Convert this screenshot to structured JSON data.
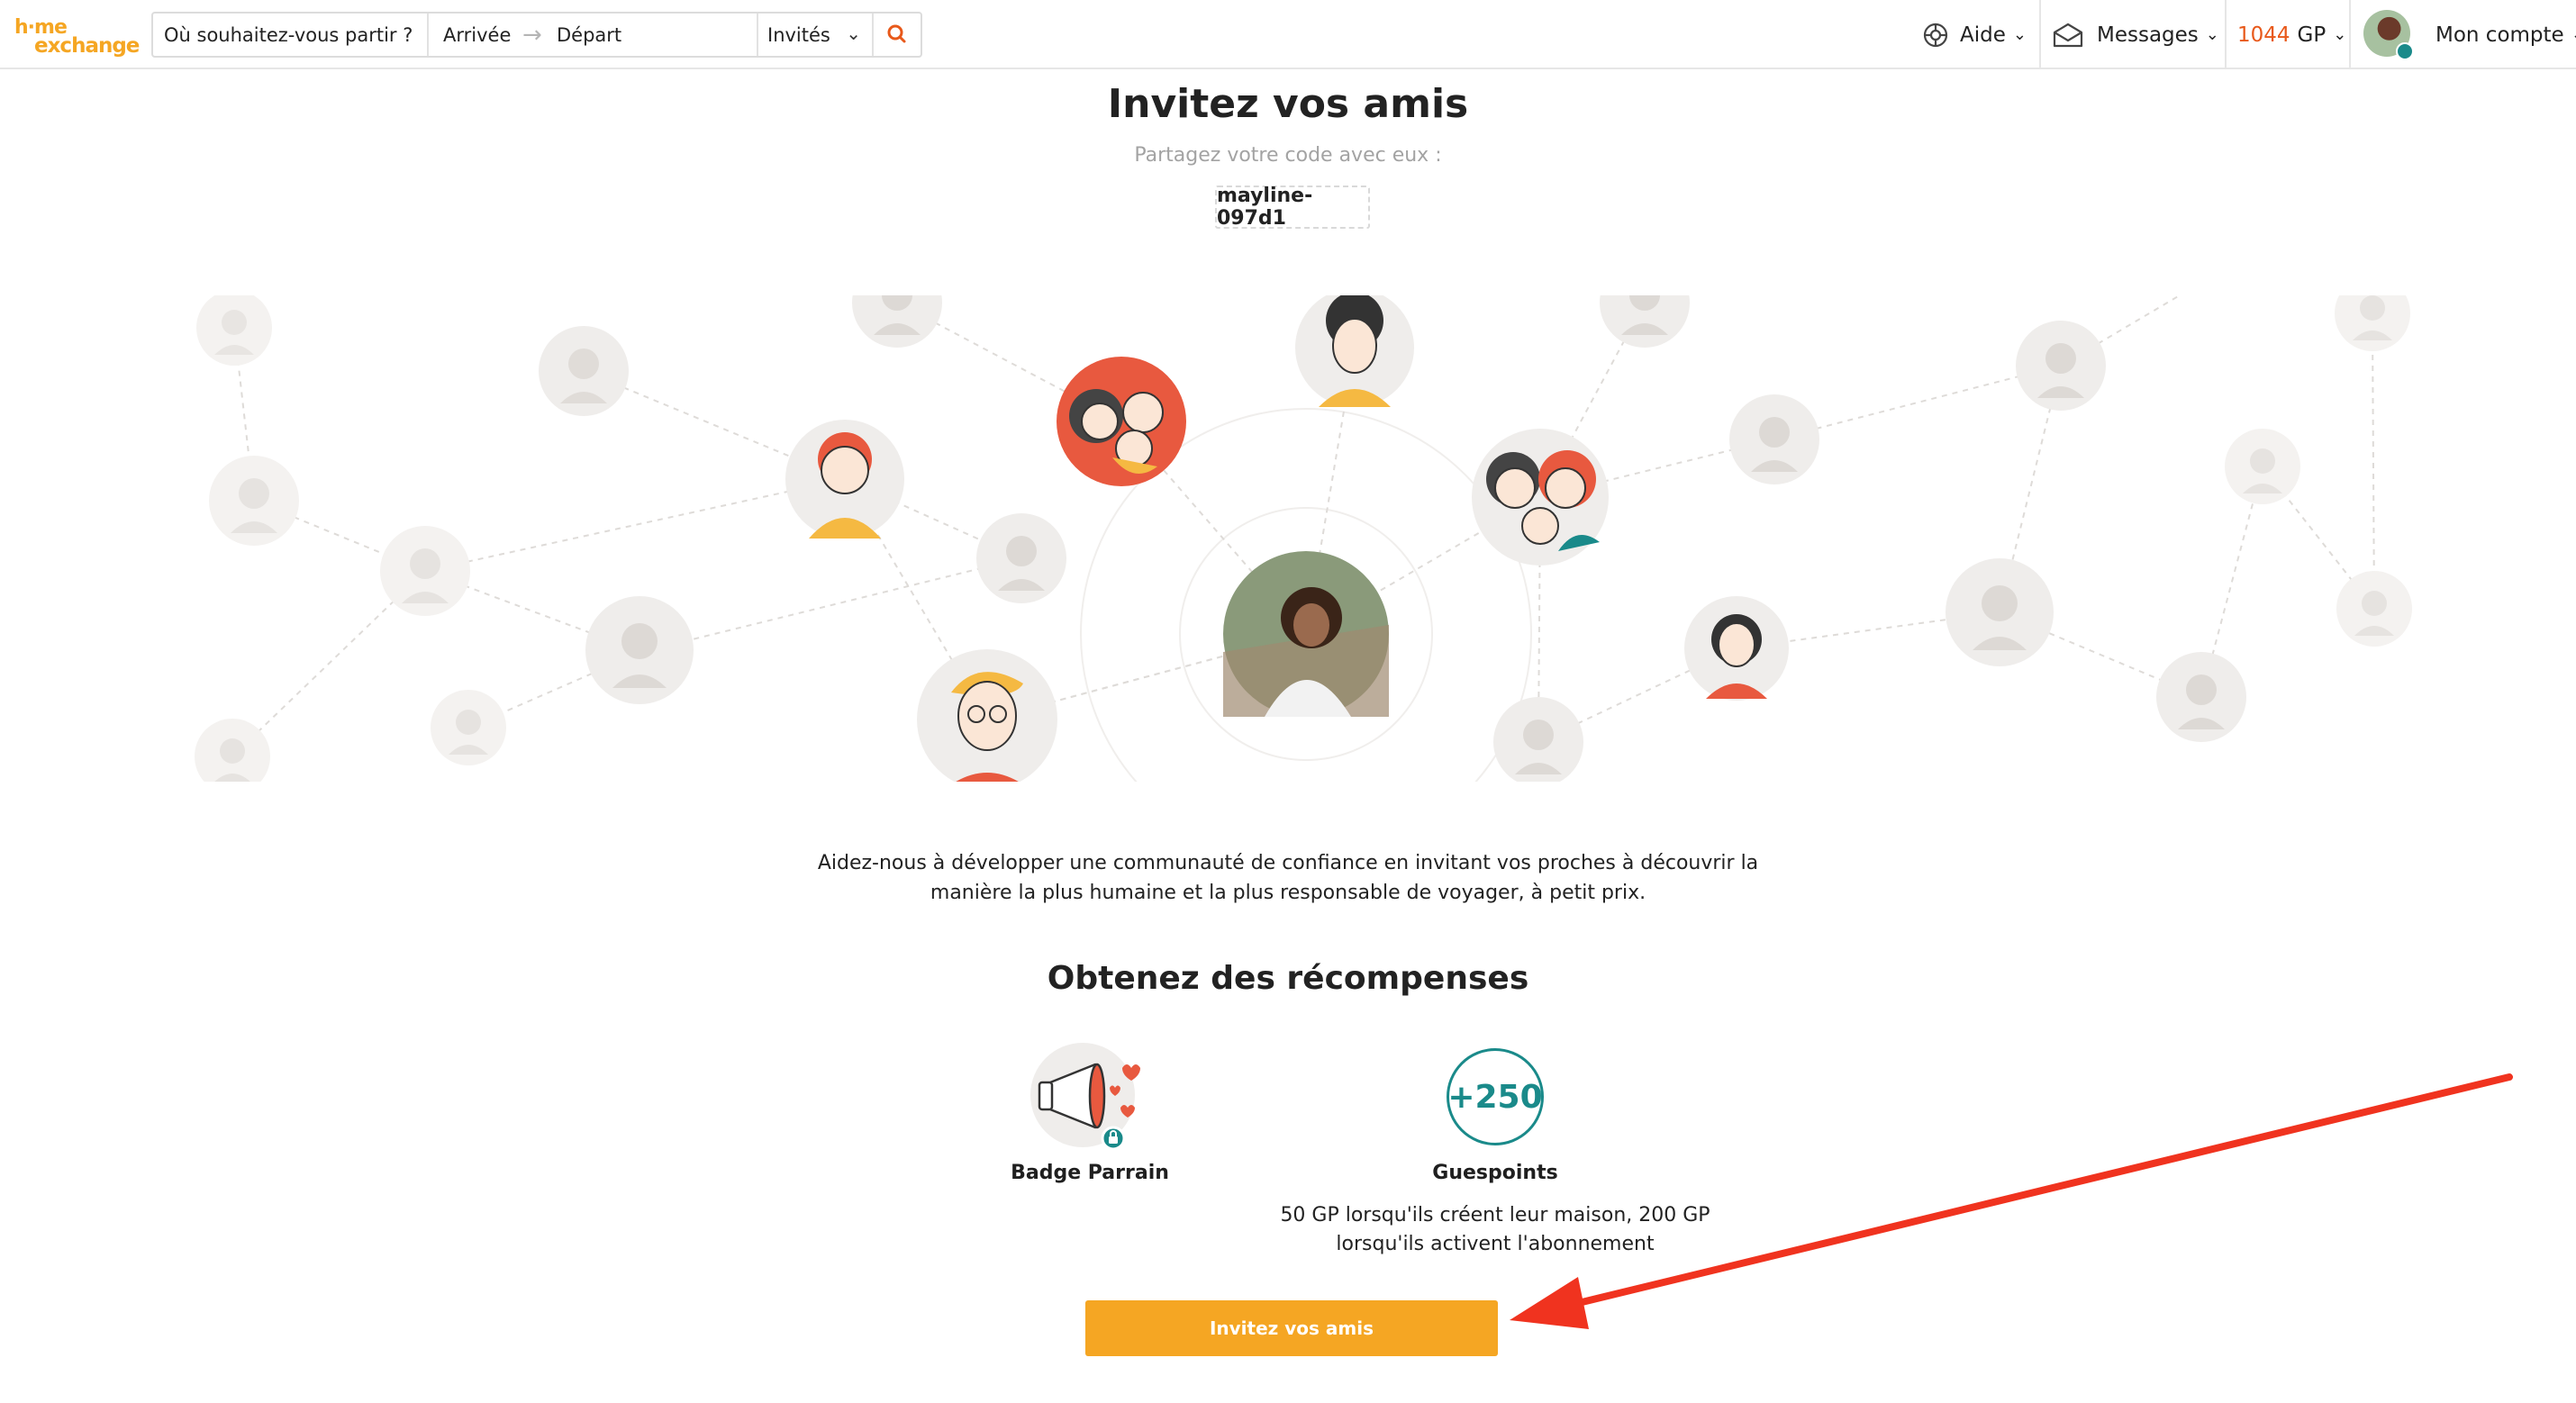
{
  "header": {
    "logo_top": "h·me",
    "logo_bottom": "exchange",
    "search": {
      "where_placeholder": "Où souhaitez-vous partir ?",
      "arrival": "Arrivée",
      "departure": "Départ",
      "guests": "Invités"
    },
    "nav": {
      "help": "Aide",
      "messages": "Messages",
      "points_value": "1044",
      "points_unit": "GP",
      "account": "Mon compte"
    }
  },
  "main": {
    "title": "Invitez vos amis",
    "subtitle": "Partagez votre code avec eux :",
    "code": "mayline-097d1",
    "description": "Aidez-nous à développer une communauté de confiance en invitant vos proches à découvrir la manière la plus humaine et la plus responsable de voyager, à petit prix.",
    "rewards_title": "Obtenez des récompenses",
    "rewards": {
      "badge_title": "Badge Parrain",
      "points_amount": "+250",
      "points_title": "Guespoints",
      "points_description": "50 GP lorsqu'ils créent leur maison, 200 GP lorsqu'ils activent l'abonnement"
    },
    "cta_label": "Invitez vos amis"
  },
  "colors": {
    "brand_orange": "#f5a623",
    "points_orange": "#e8591a",
    "teal": "#1a8a8a",
    "annotation_red": "#f0331f"
  }
}
